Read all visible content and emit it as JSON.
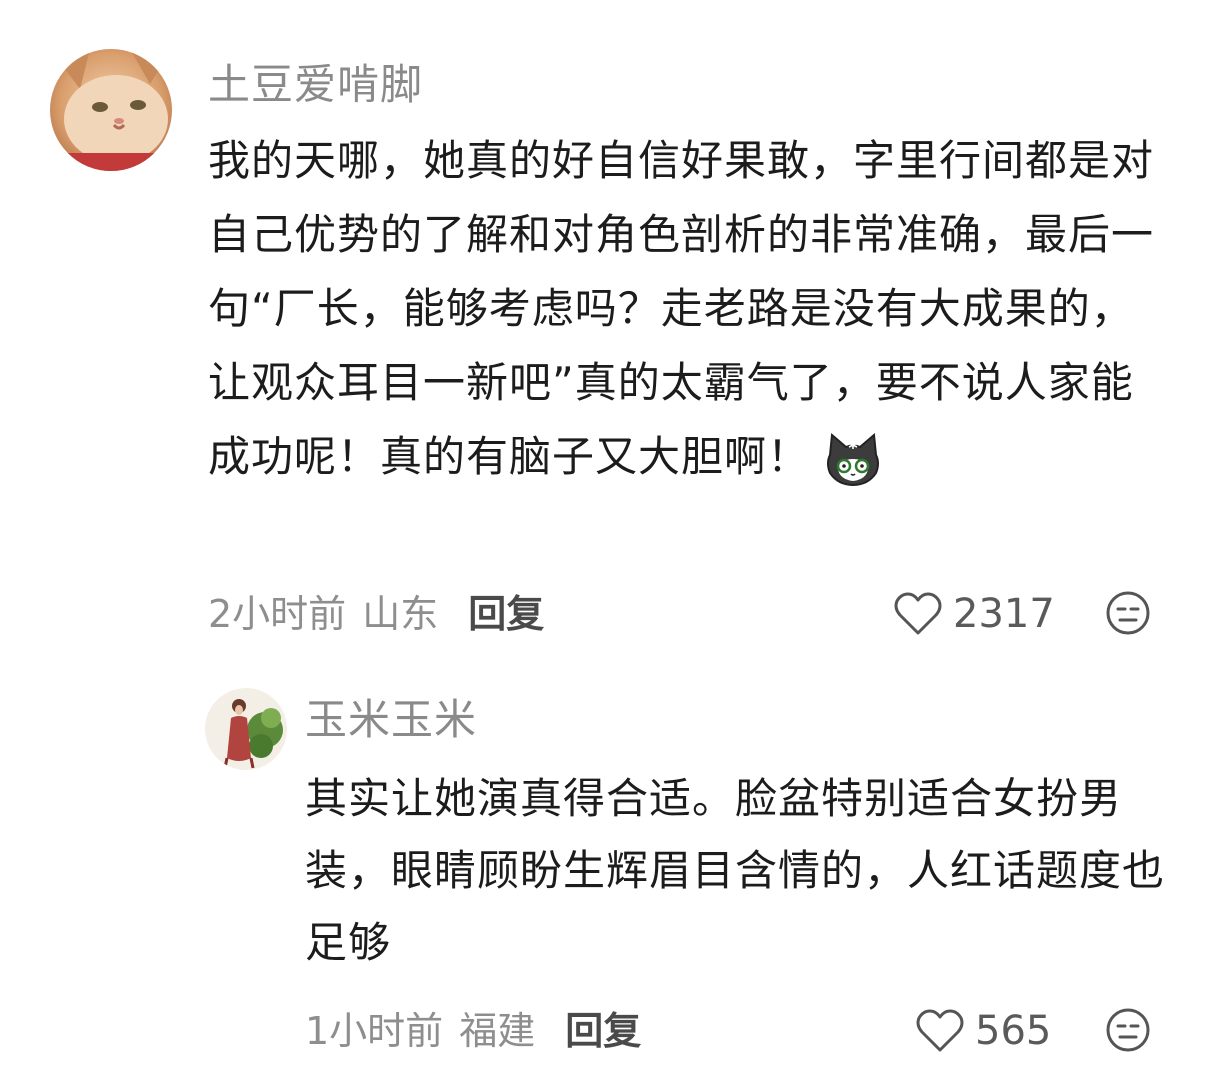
{
  "comments": [
    {
      "username": "土豆爱啃脚",
      "avatar_icon": "cat-avatar",
      "text": "我的天哪，她真的好自信好果敢，字里行间都是对自己优势的了解和对角色剖析的非常准确，最后一句“厂长，能够考虑吗？走老路是没有大成果的，让观众耳目一新吧”真的太霸气了，要不说人家能成功呢！真的有脑子又大胆啊！",
      "emoji_icon": "shocked-cat-emoji",
      "time": "2小时前",
      "location": "山东",
      "reply_label": "回复",
      "likes": "2317"
    },
    {
      "username": "玉米玉米",
      "avatar_icon": "woman-with-plants-avatar",
      "text": "其实让她演真得合适。脸盆特别适合女扮男装，眼睛顾盼生辉眉目含情的，人红话题度也足够",
      "time": "1小时前",
      "location": "福建",
      "reply_label": "回复",
      "likes": "565"
    }
  ],
  "colors": {
    "username": "#8a8a8a",
    "meta": "#8e8e8e",
    "reply": "#4a4a4a",
    "text": "#1c1c1c"
  }
}
